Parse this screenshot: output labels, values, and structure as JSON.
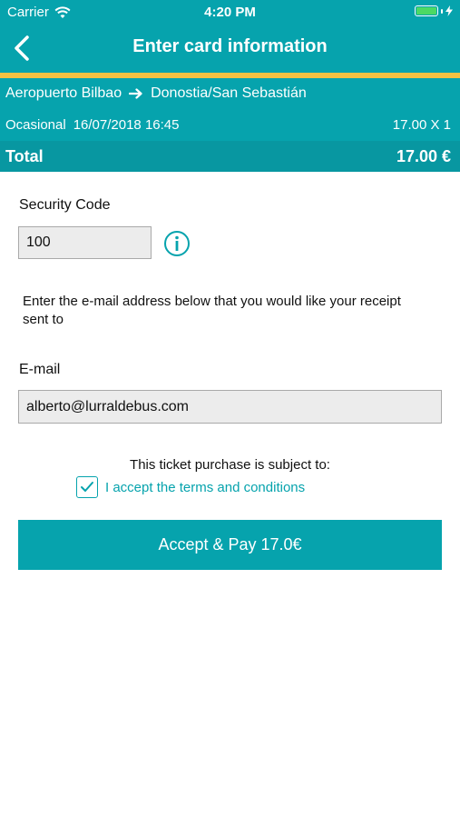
{
  "status_bar": {
    "carrier": "Carrier",
    "time": "4:20 PM",
    "battery_level": 1.0
  },
  "nav": {
    "title": "Enter card information",
    "back_icon": "chevron-left-icon"
  },
  "trip": {
    "origin": "Aeropuerto Bilbao",
    "destination": "Donostia/San Sebastián",
    "fare_type": "Ocasional",
    "datetime": "16/07/2018 16:45",
    "price_qty": "17.00 X 1",
    "total_label": "Total",
    "total_amount": "17.00 €"
  },
  "form": {
    "security_code_label": "Security Code",
    "security_code_value": "100",
    "receipt_text": "Enter the e-mail address below that you would like your receipt sent to",
    "email_label": "E-mail",
    "email_value": "alberto@lurraldebus.com",
    "subject_text": "This ticket purchase is subject to:",
    "terms_checked": true,
    "terms_link": "I accept the terms and conditions",
    "pay_button": "Accept & Pay 17.0€"
  },
  "colors": {
    "primary": "#06a3ad",
    "accent": "#f4c242",
    "battery": "#4cd964"
  }
}
